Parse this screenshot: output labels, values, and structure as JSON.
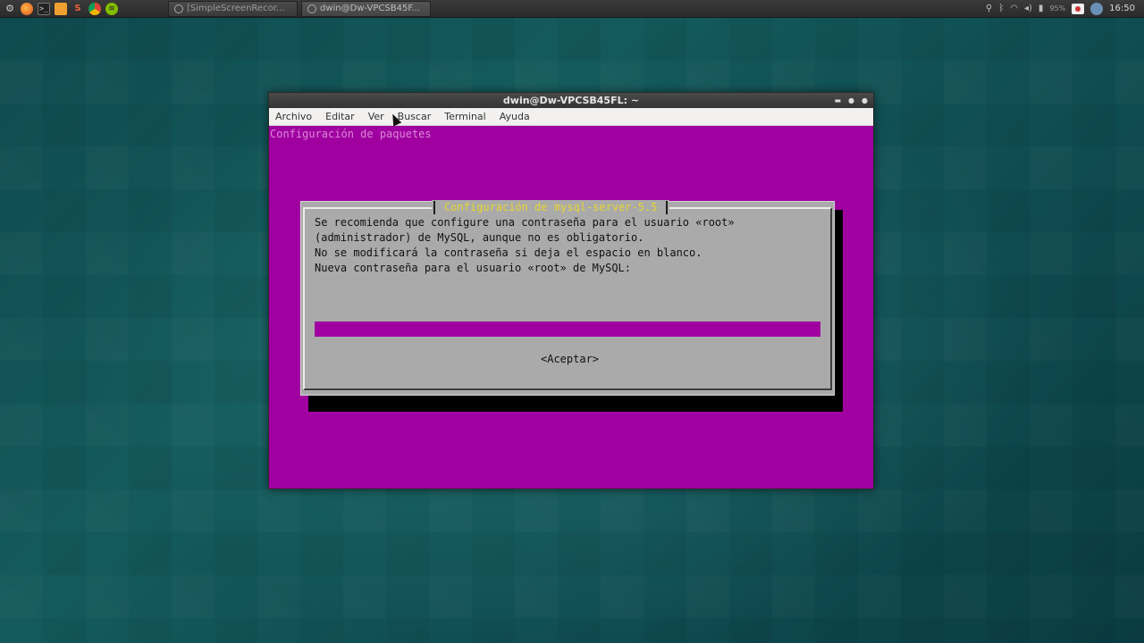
{
  "panel": {
    "tasks": [
      {
        "label": "[SimpleScreenRecor..."
      },
      {
        "label": "dwin@Dw-VPCSB45F..."
      }
    ],
    "battery": "95%",
    "clock": "16:50"
  },
  "window": {
    "title": "dwin@Dw-VPCSB45FL: ~",
    "menu": [
      "Archivo",
      "Editar",
      "Ver",
      "Buscar",
      "Terminal",
      "Ayuda"
    ]
  },
  "terminal": {
    "backtitle": "Configuración de paquetes",
    "dialog": {
      "title": "Configuración de mysql-server-5.5",
      "lines": [
        "Se recomienda que configure una contraseña para el usuario «root»",
        "(administrador) de MySQL, aunque no es obligatorio.",
        "",
        "No se modificará la contraseña si deja el espacio en blanco.",
        "",
        "Nueva contraseña para el usuario «root» de MySQL:"
      ],
      "password_value": "",
      "ok_label": "<Aceptar>"
    }
  },
  "colors": {
    "terminal_bg": "#a000a0",
    "dialog_bg": "#aaaaaa",
    "dialog_title": "#e8d530"
  }
}
